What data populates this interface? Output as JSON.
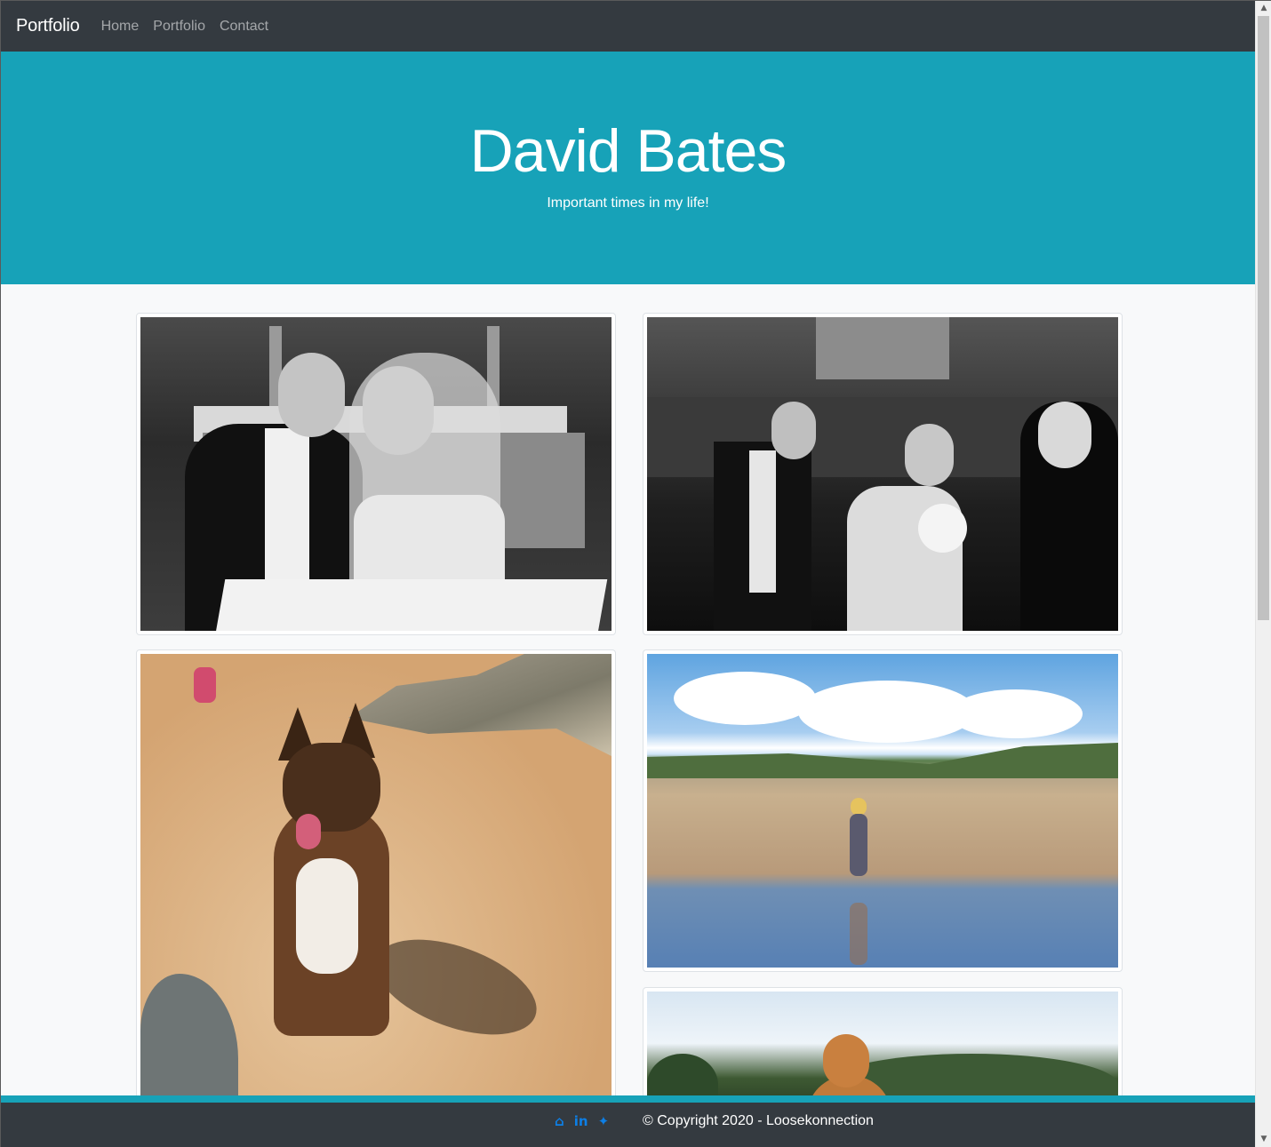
{
  "navbar": {
    "brand": "Portfolio",
    "links": [
      {
        "label": "Home"
      },
      {
        "label": "Portfolio"
      },
      {
        "label": "Contact"
      }
    ]
  },
  "hero": {
    "title": "David Bates",
    "subtitle": "Important times in my life!",
    "background": "#17a2b8"
  },
  "gallery": {
    "photos": [
      {
        "subject": "wedding-register-signing"
      },
      {
        "subject": "wedding-aisle-walk"
      },
      {
        "subject": "dog-on-beach"
      },
      {
        "subject": "child-on-beach"
      },
      {
        "subject": "buddha-statue"
      }
    ]
  },
  "footer": {
    "social_icons": [
      {
        "icon": "github-icon",
        "glyph": "⌂"
      },
      {
        "icon": "linkedin-icon",
        "glyph": "in"
      },
      {
        "icon": "twitter-icon",
        "glyph": "✦"
      }
    ],
    "copyright": "© Copyright 2020 - Loosekonnection",
    "accent": "#17a2b8",
    "background": "#343a40"
  }
}
